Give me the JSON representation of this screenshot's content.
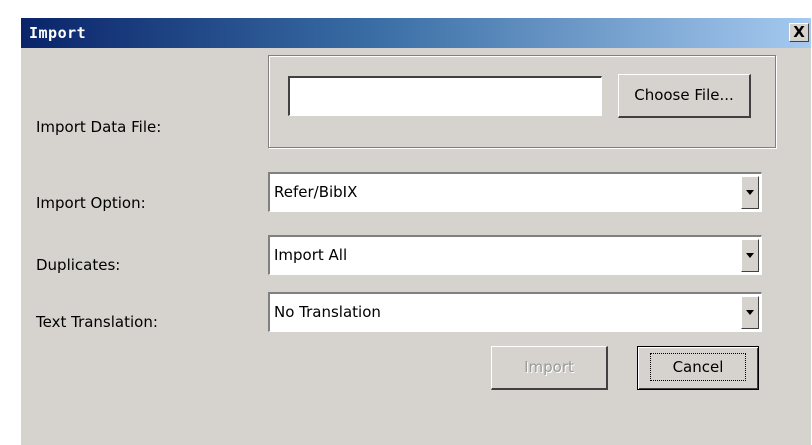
{
  "window": {
    "title": "Import",
    "close_symbol": "X"
  },
  "fields": {
    "data_file": {
      "label": "Import Data File:",
      "value": "",
      "placeholder": ""
    },
    "choose_file_button": "Choose File...",
    "import_option": {
      "label": "Import Option:",
      "selected": "Refer/BibIX"
    },
    "duplicates": {
      "label": "Duplicates:",
      "selected": "Import All"
    },
    "text_translation": {
      "label": "Text Translation:",
      "selected": "No Translation"
    }
  },
  "buttons": {
    "import": "Import",
    "cancel": "Cancel",
    "import_enabled": false
  },
  "colors": {
    "title_gradient_start": "#0a246a",
    "title_gradient_end": "#a6caf0",
    "dialog_bg": "#d6d3ce"
  }
}
